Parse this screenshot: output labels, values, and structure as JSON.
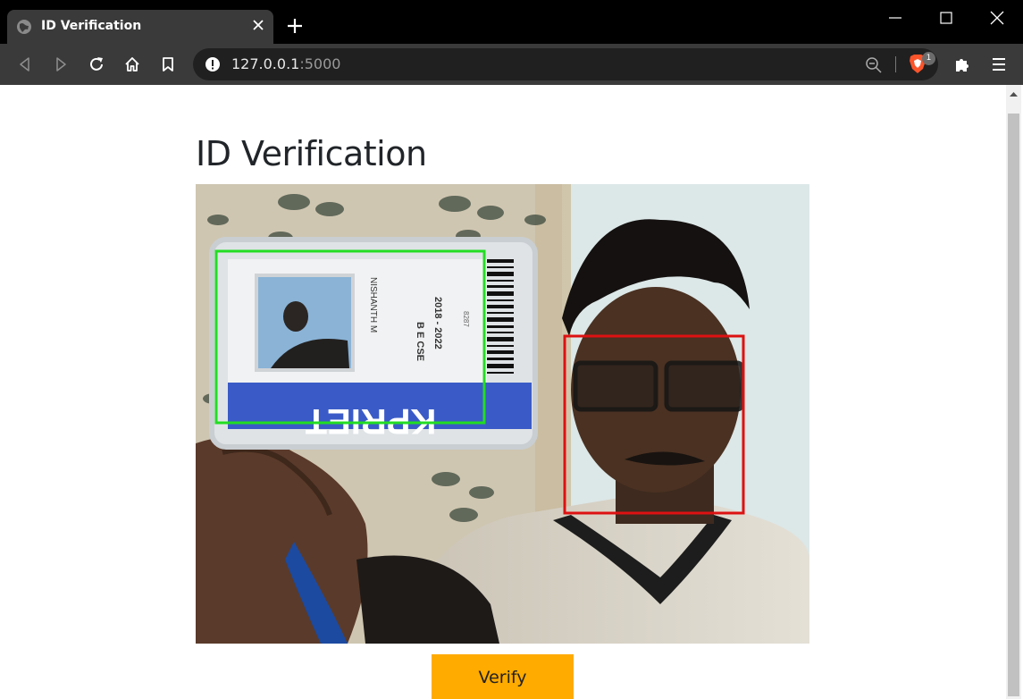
{
  "browser": {
    "tab": {
      "title": "ID Verification",
      "favicon": "globe-icon",
      "close_icon": "close-icon"
    },
    "new_tab_icon": "plus-icon",
    "window_controls": [
      "minimize-icon",
      "maximize-icon",
      "close-icon"
    ],
    "toolbar": {
      "back_icon": "back-icon",
      "forward_icon": "forward-icon",
      "reload_icon": "reload-icon",
      "home_icon": "home-icon",
      "bookmark_icon": "bookmark-icon",
      "extensions_icon": "puzzle-icon",
      "menu_icon": "hamburger-icon"
    },
    "address_bar": {
      "host": "127.0.0.1",
      "port": ":5000",
      "info_icon": "info-icon",
      "zoom_icon": "zoom-out-icon",
      "shield_badge": "1"
    }
  },
  "page": {
    "title": "ID Verification",
    "feed": {
      "id_card": {
        "name": "NISHANTH M",
        "course": "B E CSE",
        "years": "2018 - 2022",
        "code": "8287",
        "institution": "KPRIET"
      },
      "id_box_color": "#22dd22",
      "face_box_color": "#dd1111"
    },
    "verify_button": "Verify"
  },
  "colors": {
    "accent": "#ffab00",
    "chrome_dark": "#3a3a3a"
  }
}
